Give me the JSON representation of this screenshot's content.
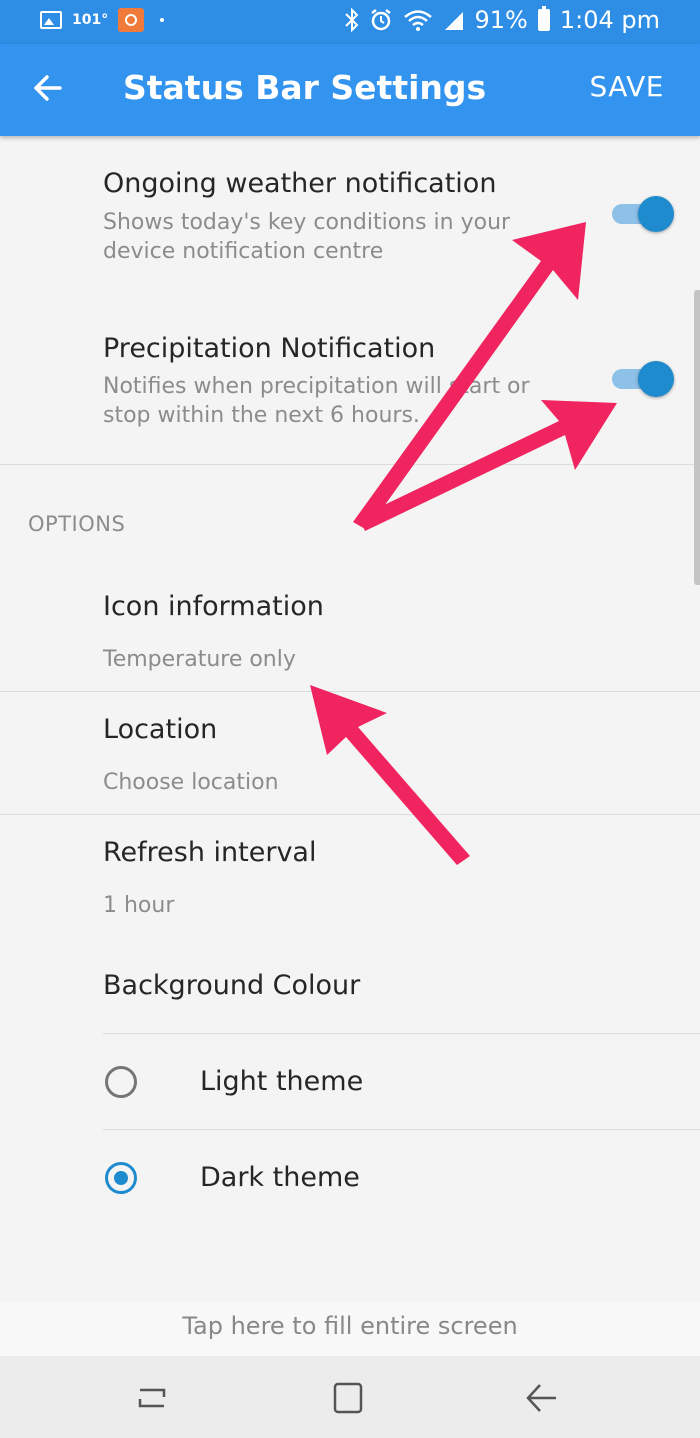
{
  "status_bar": {
    "temperature": "101°",
    "battery": "91%",
    "time": "1:04 pm"
  },
  "app_bar": {
    "title": "Status Bar Settings",
    "save_label": "SAVE"
  },
  "notifications": [
    {
      "title": "Ongoing weather notification",
      "description_line1": "Shows today's key conditions in your",
      "description_line2": "device notification centre",
      "enabled": true
    },
    {
      "title": "Precipitation Notification",
      "description_line1": "Notifies when precipitation will start or",
      "description_line2": "stop within the next 6 hours.",
      "enabled": true
    }
  ],
  "options": {
    "header": "OPTIONS",
    "items": [
      {
        "title": "Icon information",
        "value": "Temperature only"
      },
      {
        "title": "Location",
        "value": "Choose location"
      },
      {
        "title": "Refresh interval",
        "value": "1 hour"
      }
    ],
    "background": {
      "title": "Background Colour",
      "choices": [
        {
          "label": "Light theme",
          "selected": false
        },
        {
          "label": "Dark theme",
          "selected": true
        }
      ]
    }
  },
  "footer": {
    "fill_screen_label": "Tap here to fill entire screen"
  },
  "colors": {
    "accent": "#3294ee",
    "toggle_on": "#1f8bcf",
    "annotation_arrow": "#f0245f"
  }
}
